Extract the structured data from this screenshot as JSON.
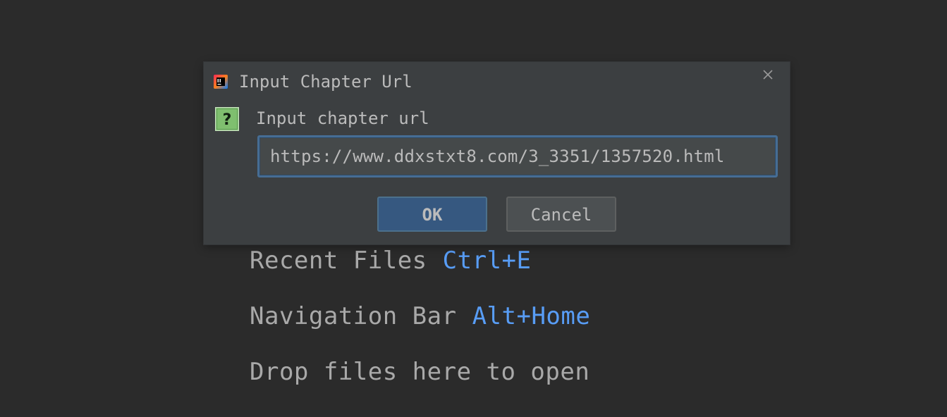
{
  "background_hints": {
    "recent_files": {
      "label": "Recent Files",
      "shortcut": "Ctrl+E"
    },
    "navigation_bar": {
      "label": "Navigation Bar",
      "shortcut": "Alt+Home"
    },
    "drop_files": {
      "label": "Drop files here to open"
    }
  },
  "dialog": {
    "title": "Input Chapter Url",
    "prompt": "Input chapter url",
    "url_value": "https://www.ddxstxt8.com/3_3351/1357520.html",
    "ok_label": "OK",
    "cancel_label": "Cancel",
    "icons": {
      "app": "intellij-app-icon",
      "question": "question-icon",
      "close": "close-icon"
    }
  },
  "colors": {
    "background": "#2b2b2b",
    "dialog_bg": "#3c3f41",
    "text": "#bbbbbb",
    "shortcut": "#589df6",
    "focus_border": "#466d94",
    "ok_button": "#365880"
  }
}
